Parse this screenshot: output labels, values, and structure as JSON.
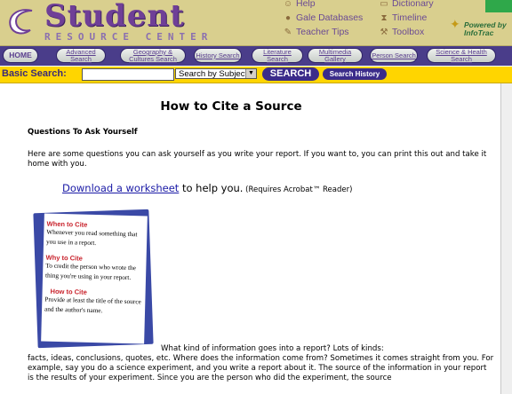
{
  "header": {
    "logo_title": "Student",
    "logo_subtitle": "RESOURCE CENTER",
    "links": [
      {
        "label": "Help",
        "icon": "help-icon"
      },
      {
        "label": "Gale Databases",
        "icon": "database-icon"
      },
      {
        "label": "Teacher Tips",
        "icon": "teacher-tips-icon"
      },
      {
        "label": "Dictionary",
        "icon": "dictionary-icon"
      },
      {
        "label": "Timeline",
        "icon": "timeline-icon"
      },
      {
        "label": "Toolbox",
        "icon": "toolbox-icon"
      }
    ],
    "powered_by": "Powered by InfoTrac"
  },
  "nav": {
    "buttons": [
      {
        "label": "HOME"
      },
      {
        "label": "Advanced Search"
      },
      {
        "label": "Geography & Cultures Search"
      },
      {
        "label": "History Search"
      },
      {
        "label": "Literature Search"
      },
      {
        "label": "Multimedia Gallery"
      },
      {
        "label": "Person Search"
      },
      {
        "label": "Science & Health Search"
      }
    ]
  },
  "search": {
    "label": "Basic Search:",
    "input_value": "",
    "select_value": "Search by Subject",
    "button_label": "SEARCH",
    "history_label": "Search History"
  },
  "content": {
    "title": "How to Cite a Source",
    "heading": "Questions To Ask Yourself",
    "intro": "Here are some questions you can ask yourself as you write your report. If you want to, you can print this out and take it home with you.",
    "download_link": "Download a worksheet",
    "download_suffix": " to help you.",
    "download_note": " (Requires Acrobat™ Reader)",
    "card": {
      "h1": "When to Cite",
      "t1": "Whenever you read something that you use in a report.",
      "h2": "Why to Cite",
      "t2": "To credit the person who wrote the thing you're using in your report.",
      "h3": "How to Cite",
      "t3": "Provide at least the title of the source and the author's name."
    },
    "body_first": "What kind of information goes into a report? Lots of kinds:",
    "body_rest": "facts, ideas, conclusions, quotes, etc. Where does the information come from? Sometimes it comes straight from you. For example, say you do a science experiment, and you write a report about it. The source of the information in your report is the results of your experiment. Since you are the person who did the experiment, the source"
  }
}
